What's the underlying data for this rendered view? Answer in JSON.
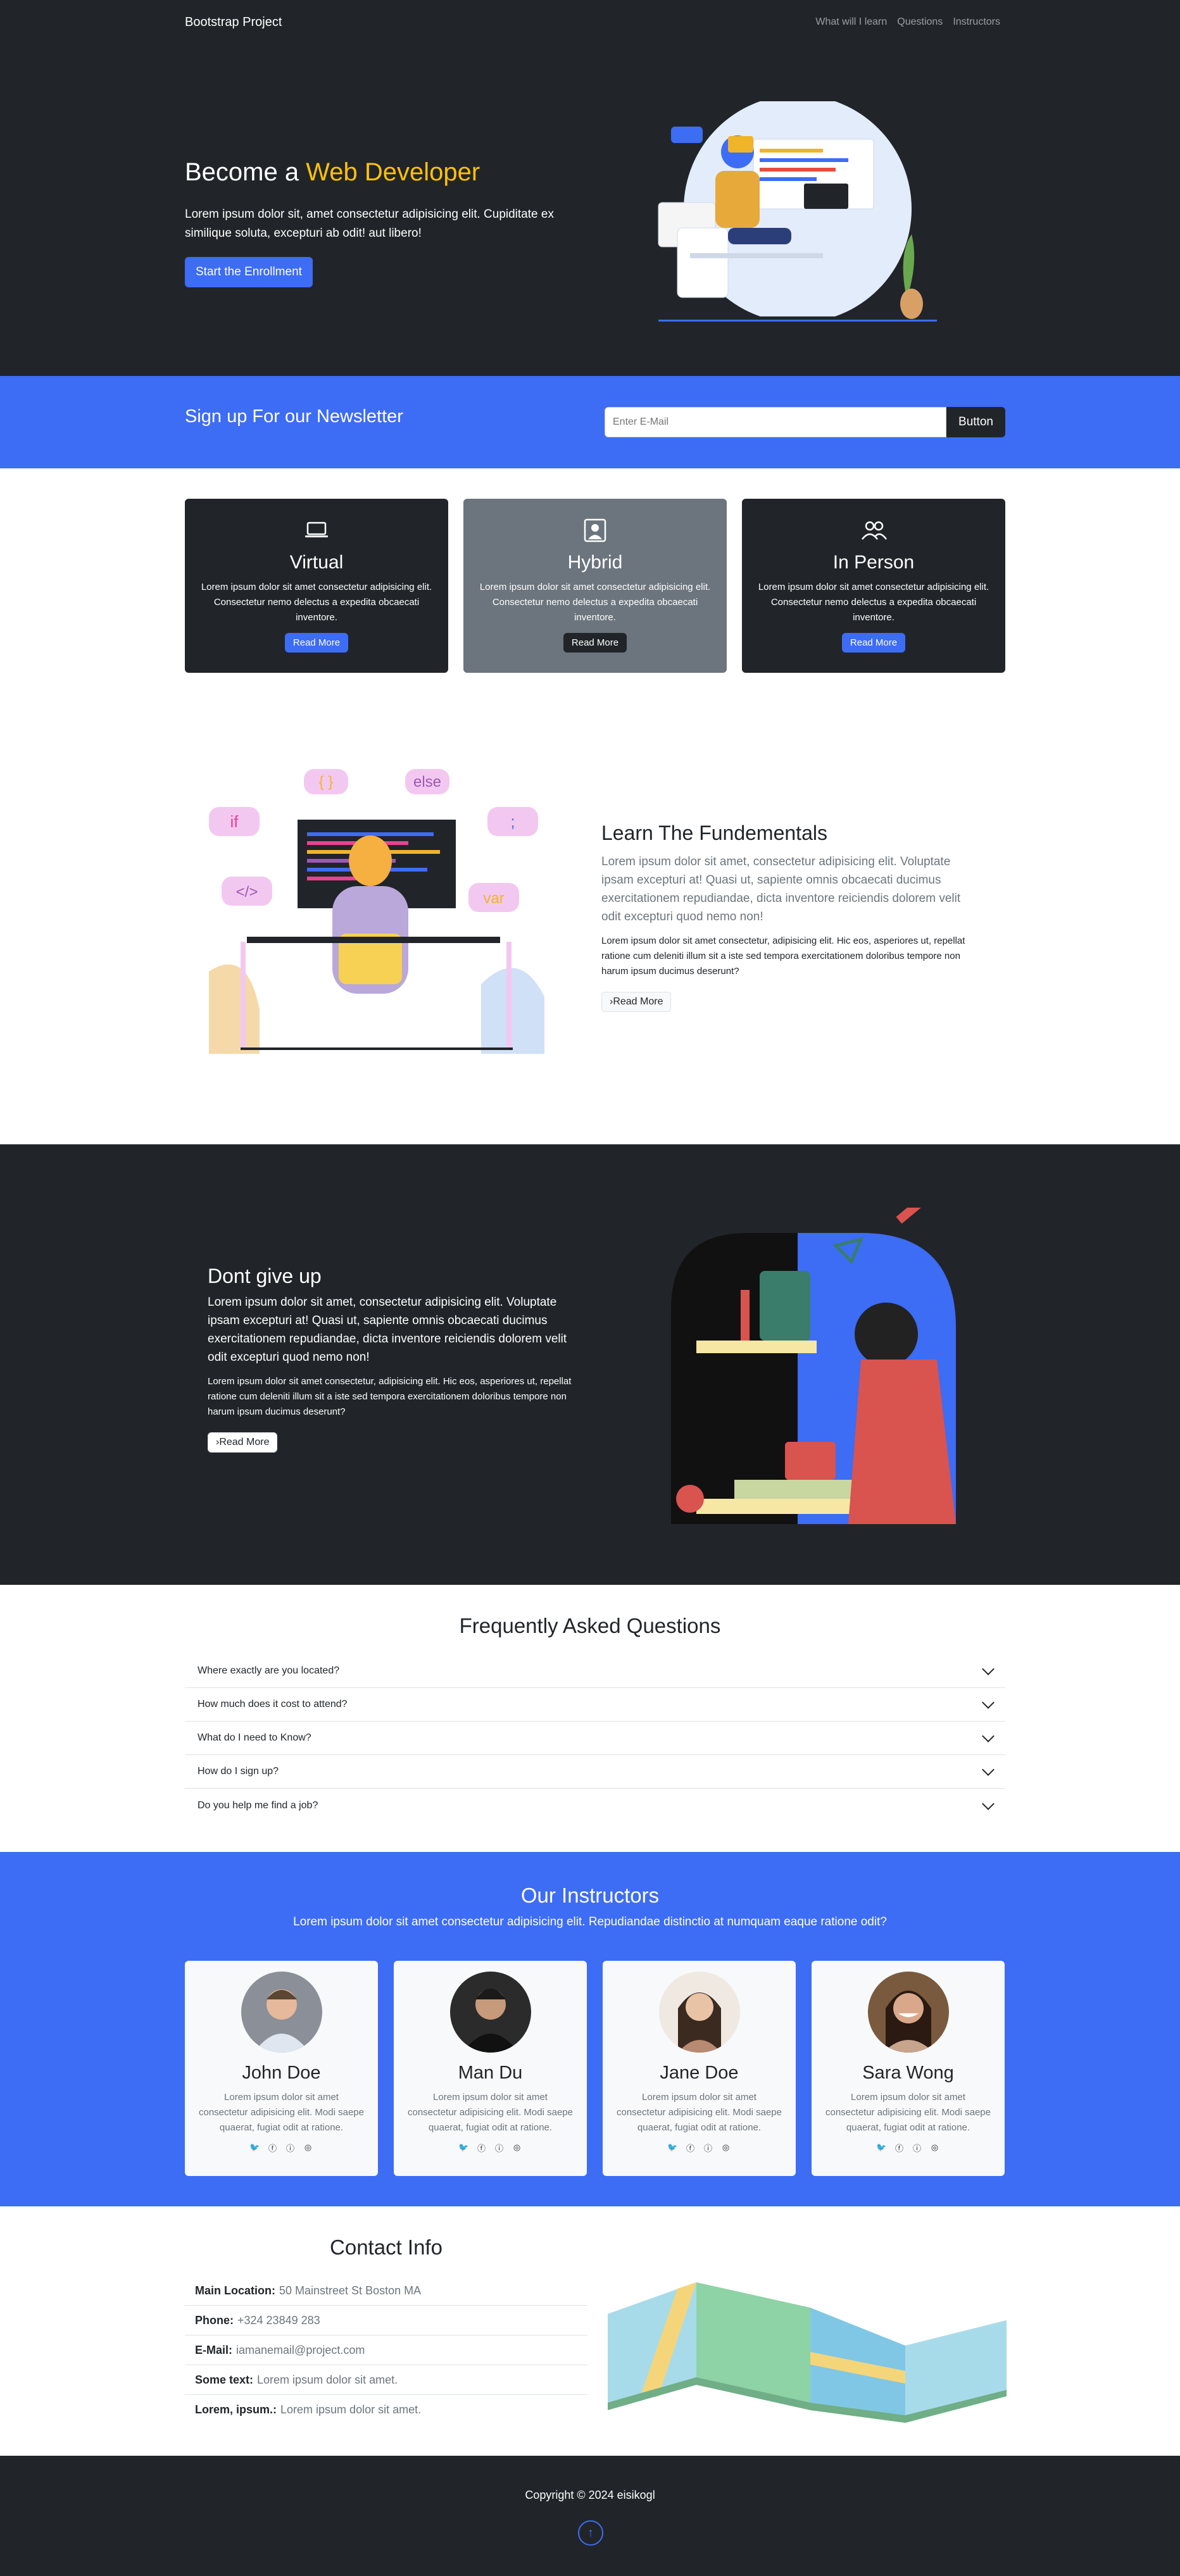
{
  "nav": {
    "brand": "Bootstrap Project",
    "links": [
      "What will I learn",
      "Questions",
      "Instructors"
    ]
  },
  "hero": {
    "title_prefix": "Become a ",
    "title_accent": "Web Developer",
    "lead": "Lorem ipsum dolor sit, amet consectetur adipisicing elit. Cupiditate ex similique soluta, excepturi ab odit! aut libero!",
    "cta": "Start the Enrollment",
    "accent_color": "#ffc107"
  },
  "newsletter": {
    "title": "Sign up For our Newsletter",
    "placeholder": "Enter E-Mail",
    "button": "Button",
    "bg_color": "#3d6cf5"
  },
  "boxes": [
    {
      "icon": "laptop-icon",
      "title": "Virtual",
      "text": "Lorem ipsum dolor sit amet consectetur adipisicing elit. Consectetur nemo delectus a expedita obcaecati inventore.",
      "button": "Read More"
    },
    {
      "icon": "person-badge-icon",
      "title": "Hybrid",
      "text": "Lorem ipsum dolor sit amet consectetur adipisicing elit. Consectetur nemo delectus a expedita obcaecati inventore.",
      "button": "Read More"
    },
    {
      "icon": "people-icon",
      "title": "In Person",
      "text": "Lorem ipsum dolor sit amet consectetur adipisicing elit. Consectetur nemo delectus a expedita obcaecati inventore.",
      "button": "Read More"
    }
  ],
  "learn": {
    "title": "Learn The Fundementals",
    "lead": "Lorem ipsum dolor sit amet, consectetur adipisicing elit. Voluptate ipsam excepturi at! Quasi ut, sapiente omnis obcaecati ducimus exercitationem repudiandae, dicta inventore reiciendis dolorem velit odit excepturi quod nemo non!",
    "body": "Lorem ipsum dolor sit amet consectetur, adipisicing elit. Hic eos, asperiores ut, repellat ratione cum deleniti illum sit a iste sed tempora exercitationem doloribus tempore non harum ipsum ducimus deserunt?",
    "button": "Read More",
    "art_labels": [
      "{ }",
      "else",
      "if",
      ";",
      "</>",
      "var"
    ]
  },
  "dont": {
    "title": "Dont give up",
    "lead": "Lorem ipsum dolor sit amet, consectetur adipisicing elit. Voluptate ipsam excepturi at! Quasi ut, sapiente omnis obcaecati ducimus exercitationem repudiandae, dicta inventore reiciendis dolorem velit odit excepturi quod nemo non!",
    "body": "Lorem ipsum dolor sit amet consectetur, adipisicing elit. Hic eos, asperiores ut, repellat ratione cum deleniti illum sit a iste sed tempora exercitationem doloribus tempore non harum ipsum ducimus deserunt?",
    "button": "Read More"
  },
  "faq": {
    "title": "Frequently Asked Questions",
    "items": [
      "Where exactly are you located?",
      "How much does it cost to attend?",
      "What do I need to Know?",
      "How do I sign up?",
      "Do you help me find a job?"
    ]
  },
  "instructors": {
    "title": "Our Instructors",
    "subtitle": "Lorem ipsum dolor sit amet consectetur adipisicing elit. Repudiandae distinctio at numquam eaque ratione odit?",
    "people": [
      {
        "name": "John Doe",
        "bio": "Lorem ipsum dolor sit amet consectetur adipisicing elit. Modi saepe quaerat, fugiat odit at ratione."
      },
      {
        "name": "Man Du",
        "bio": "Lorem ipsum dolor sit amet consectetur adipisicing elit. Modi saepe quaerat, fugiat odit at ratione."
      },
      {
        "name": "Jane Doe",
        "bio": "Lorem ipsum dolor sit amet consectetur adipisicing elit. Modi saepe quaerat, fugiat odit at ratione."
      },
      {
        "name": "Sara Wong",
        "bio": "Lorem ipsum dolor sit amet consectetur adipisicing elit. Modi saepe quaerat, fugiat odit at ratione."
      }
    ]
  },
  "contact": {
    "title": "Contact Info",
    "rows": [
      {
        "label": "Main Location:",
        "value": "50 Mainstreet St Boston MA"
      },
      {
        "label": "Phone:",
        "value": "+324 23849 283"
      },
      {
        "label": "E-Mail:",
        "value": "iamanemail@project.com"
      },
      {
        "label": "Some text:",
        "value": "Lorem ipsum dolor sit amet."
      },
      {
        "label": "Lorem, ipsum.:",
        "value": "Lorem ipsum dolor sit amet."
      }
    ]
  },
  "footer": {
    "copyright": "Copyright © 2024 eisikogl"
  }
}
